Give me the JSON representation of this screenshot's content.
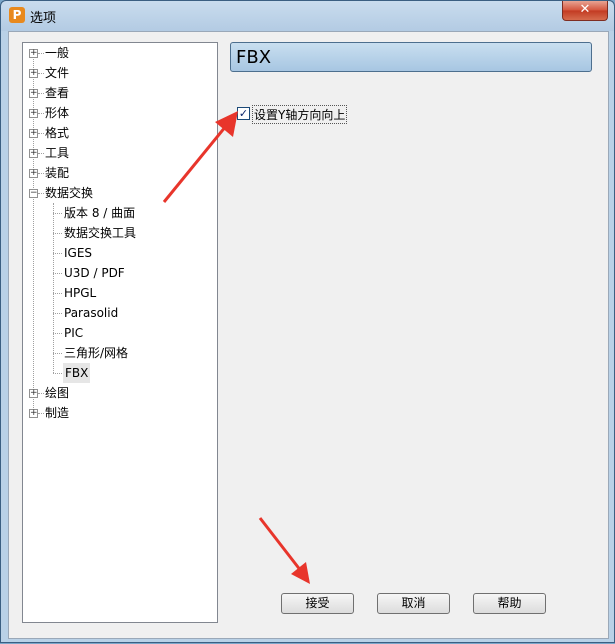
{
  "window": {
    "title": "选项",
    "app_icon": "P",
    "close_label": "✕"
  },
  "tree": {
    "top_items": [
      {
        "label": "一般",
        "expander": "+"
      },
      {
        "label": "文件",
        "expander": "+"
      },
      {
        "label": "查看",
        "expander": "+"
      },
      {
        "label": "形体",
        "expander": "+"
      },
      {
        "label": "格式",
        "expander": "+"
      },
      {
        "label": "工具",
        "expander": "+"
      },
      {
        "label": "装配",
        "expander": "+"
      },
      {
        "label": "数据交换",
        "expander": "−"
      }
    ],
    "children": [
      {
        "label": "版本 8 / 曲面"
      },
      {
        "label": "数据交换工具"
      },
      {
        "label": "IGES"
      },
      {
        "label": "U3D / PDF"
      },
      {
        "label": "HPGL"
      },
      {
        "label": "Parasolid"
      },
      {
        "label": "PIC"
      },
      {
        "label": "三角形/网格"
      },
      {
        "label": "FBX"
      }
    ],
    "bottom_items": [
      {
        "label": "绘图",
        "expander": "+"
      },
      {
        "label": "制造",
        "expander": "+"
      }
    ]
  },
  "panel": {
    "title": "FBX"
  },
  "option": {
    "label": "设置Y轴方向向上",
    "checked": true,
    "check_glyph": "✓"
  },
  "buttons": {
    "accept": "接受",
    "cancel": "取消",
    "help": "帮助"
  },
  "colors": {
    "arrow": "#e8352b",
    "header": "#b6d0e8"
  }
}
